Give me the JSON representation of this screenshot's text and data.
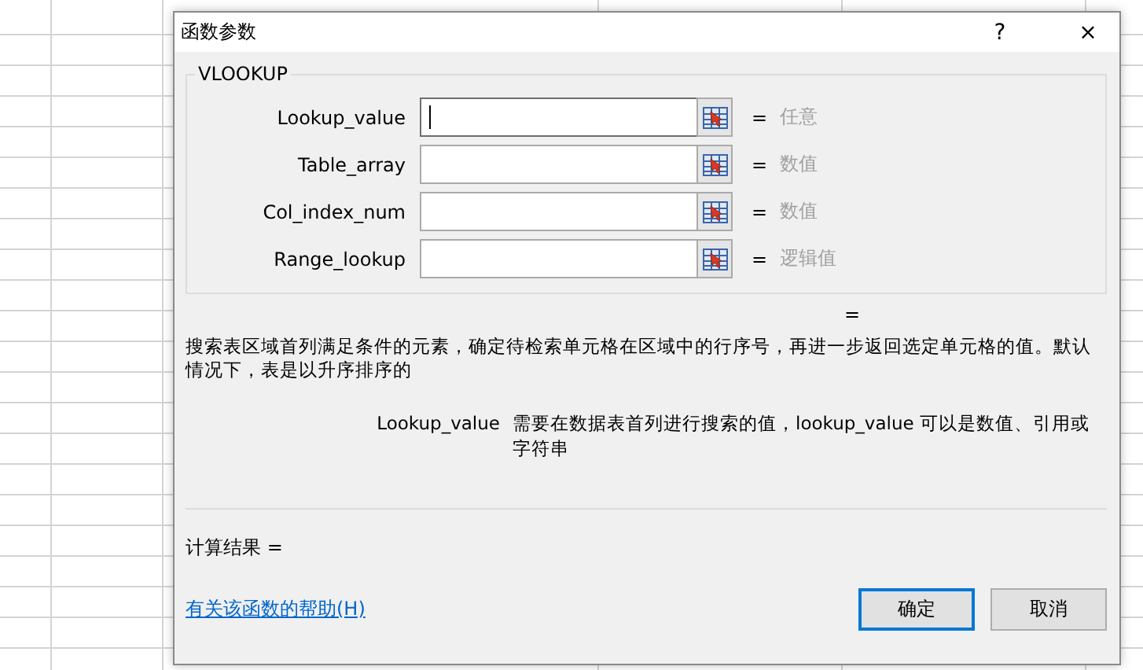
{
  "window": {
    "title": "函数参数",
    "controls": [
      "?",
      "×"
    ]
  },
  "function_group": {
    "title": "VLOOKUP",
    "arguments": [
      {
        "label": "Lookup_value",
        "focused": true,
        "equals": "=",
        "result": "任意"
      },
      {
        "label": "Table_array",
        "focused": false,
        "equals": "=",
        "result": "数值"
      },
      {
        "label": "Col_index_num",
        "focused": false,
        "equals": "=",
        "result": "数值"
      },
      {
        "label": "Range_lookup",
        "focused": false,
        "equals": "=",
        "result": "逻辑值"
      }
    ]
  },
  "formula_result": "=",
  "description": "搜索表区域首列满足条件的元素，确定待检索单元格在区域中的行序号，再进一步返回选定单元格的值。默认情况下，表是以升序排序的",
  "argument_help": {
    "name": "Lookup_value",
    "text": "需要在数据表首列进行搜索的值，lookup_value 可以是数值、引用或字符串"
  },
  "result_label": "计算结果 =",
  "help_link": "有关该函数的帮助(H)",
  "buttons": [
    {
      "label": "确定",
      "default": true
    },
    {
      "label": "取消",
      "default": false
    }
  ]
}
